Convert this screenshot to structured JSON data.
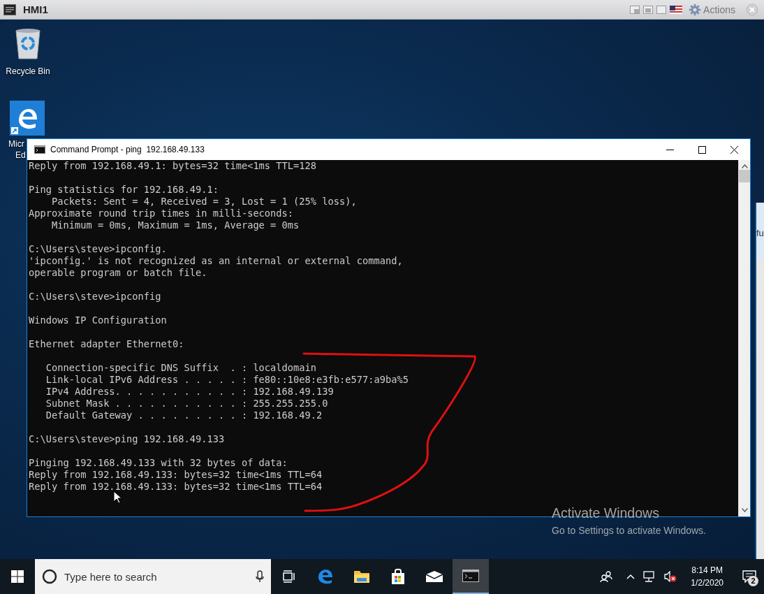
{
  "vm_bar": {
    "title": "HMI1",
    "actions": "Actions"
  },
  "desktop_icons": [
    {
      "kind": "recycle",
      "label_lines": [
        "Recycle Bin"
      ]
    },
    {
      "kind": "edge",
      "label_lines": [
        "Micr",
        "Ed"
      ]
    }
  ],
  "background_window": {
    "text": "fu"
  },
  "cmd_window": {
    "title": "Command Prompt - ping  192.168.49.133",
    "blocks": [
      {
        "kind": "output",
        "lines": [
          "Reply from 192.168.49.1: bytes=32 time<1ms TTL=128"
        ]
      },
      {
        "kind": "output",
        "lines": [
          "Ping statistics for 192.168.49.1:",
          "    Packets: Sent = 4, Received = 3, Lost = 1 (25% loss),",
          "Approximate round trip times in milli-seconds:",
          "    Minimum = 0ms, Maximum = 1ms, Average = 0ms"
        ]
      },
      {
        "kind": "output",
        "lines": [
          "C:\\Users\\steve>ipconfig.",
          "'ipconfig.' is not recognized as an internal or external command,",
          "operable program or batch file."
        ]
      },
      {
        "kind": "output",
        "lines": [
          "C:\\Users\\steve>ipconfig"
        ]
      },
      {
        "kind": "output",
        "lines": [
          "Windows IP Configuration"
        ]
      },
      {
        "kind": "section",
        "lines": [
          "Ethernet adapter Ethernet0:"
        ]
      },
      {
        "kind": "output",
        "lines": [
          "   Connection-specific DNS Suffix  . : localdomain",
          "   Link-local IPv6 Address . . . . . : fe80::10e8:e3fb:e577:a9ba%5",
          "   IPv4 Address. . . . . . . . . . . : 192.168.49.139",
          "   Subnet Mask . . . . . . . . . . . : 255.255.255.0",
          "   Default Gateway . . . . . . . . . : 192.168.49.2"
        ]
      },
      {
        "kind": "output",
        "lines": [
          "C:\\Users\\steve>ping 192.168.49.133"
        ]
      },
      {
        "kind": "output",
        "lines": [
          "Pinging 192.168.49.133 with 32 bytes of data:",
          "Reply from 192.168.49.133: bytes=32 time<1ms TTL=64",
          "Reply from 192.168.49.133: bytes=32 time<1ms TTL=64"
        ]
      }
    ]
  },
  "activation_notice": {
    "title": "Activate Windows",
    "message": "Go to Settings to activate Windows."
  },
  "taskbar": {
    "search": {
      "placeholder": "Type here to search"
    },
    "apps": [
      {
        "kind": "task-view",
        "selected": false
      },
      {
        "kind": "edge",
        "selected": false
      },
      {
        "kind": "explorer",
        "selected": false
      },
      {
        "kind": "store",
        "selected": false
      },
      {
        "kind": "mail",
        "selected": false
      },
      {
        "kind": "cmd",
        "selected": true
      }
    ],
    "clock": {
      "time": "8:14 PM",
      "date": "1/2/2020"
    },
    "notifications": {
      "count": "2"
    }
  }
}
